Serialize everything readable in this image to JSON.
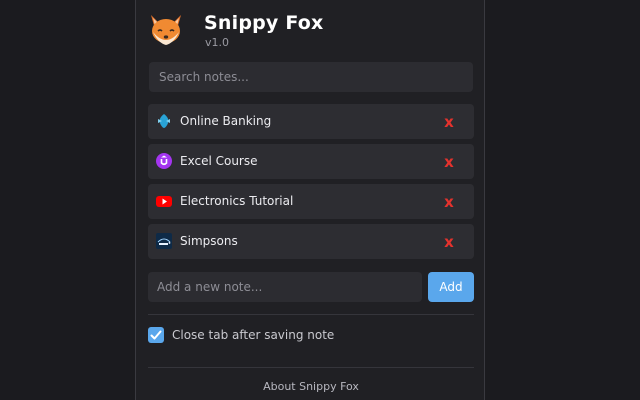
{
  "app": {
    "title": "Snippy Fox",
    "version": "v1.0",
    "logo_icon": "fox-logo-icon"
  },
  "search": {
    "placeholder": "Search notes..."
  },
  "notes": [
    {
      "title": "Online Banking",
      "icon": "eagle-bank-icon",
      "delete_label": "x"
    },
    {
      "title": "Excel Course",
      "icon": "udemy-icon",
      "delete_label": "x"
    },
    {
      "title": "Electronics Tutorial",
      "icon": "youtube-icon",
      "delete_label": "x"
    },
    {
      "title": "Simpsons",
      "icon": "disney-plus-icon",
      "delete_label": "x"
    }
  ],
  "new_note": {
    "placeholder": "Add a new note...",
    "add_label": "Add"
  },
  "settings": {
    "close_tab_label": "Close tab after saving note",
    "close_tab_checked": true
  },
  "footer": {
    "about_label": "About Snippy Fox"
  },
  "colors": {
    "background": "#1b1b1f",
    "panel": "#202024",
    "accent": "#5aa7ec",
    "delete": "#e5322d"
  }
}
